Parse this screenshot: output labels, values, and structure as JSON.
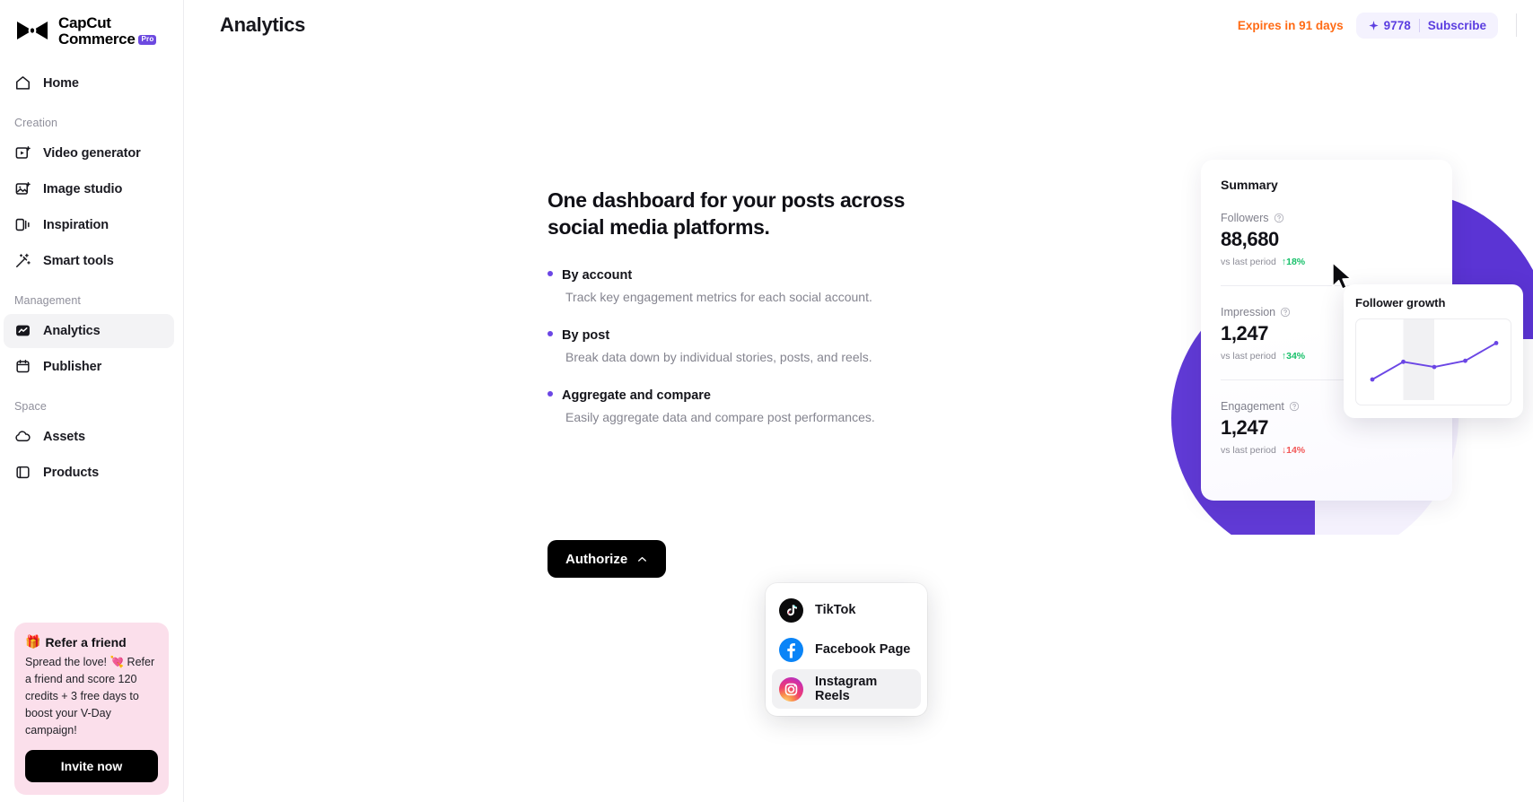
{
  "brand": {
    "line1": "CapCut",
    "line2": "Commerce",
    "badge": "Pro"
  },
  "sidebar": {
    "home": {
      "label": "Home",
      "icon": "home-icon"
    },
    "sections": [
      {
        "label": "Creation",
        "items": [
          {
            "label": "Video generator",
            "icon": "video-generator-icon"
          },
          {
            "label": "Image studio",
            "icon": "image-studio-icon"
          },
          {
            "label": "Inspiration",
            "icon": "inspiration-icon"
          },
          {
            "label": "Smart tools",
            "icon": "smart-tools-icon"
          }
        ]
      },
      {
        "label": "Management",
        "items": [
          {
            "label": "Analytics",
            "icon": "analytics-icon"
          },
          {
            "label": "Publisher",
            "icon": "publisher-icon"
          }
        ]
      },
      {
        "label": "Space",
        "items": [
          {
            "label": "Assets",
            "icon": "assets-icon"
          },
          {
            "label": "Products",
            "icon": "products-icon"
          }
        ]
      }
    ],
    "refer": {
      "emoji": "🎁",
      "title": "Refer a friend",
      "body": "Spread the love! 💘 Refer a friend and score 120 credits + 3 free days to boost your V-Day campaign!",
      "cta": "Invite now"
    }
  },
  "header": {
    "title": "Analytics",
    "expires": "Expires in 91 days",
    "credits": "9778",
    "subscribe": "Subscribe"
  },
  "hero": {
    "heading": "One dashboard for your posts across social media platforms.",
    "features": [
      {
        "title": "By account",
        "desc": "Track key engagement metrics for each social account."
      },
      {
        "title": "By post",
        "desc": "Break data down by individual stories, posts, and reels."
      },
      {
        "title": "Aggregate and compare",
        "desc": "Easily aggregate data and compare post performances."
      }
    ],
    "authorize_label": "Authorize",
    "menu": [
      {
        "label": "TikTok",
        "icon": "tiktok-icon"
      },
      {
        "label": "Facebook Page",
        "icon": "facebook-icon"
      },
      {
        "label": "Instagram Reels",
        "icon": "instagram-icon"
      }
    ]
  },
  "summary": {
    "title": "Summary",
    "metrics": [
      {
        "label": "Followers",
        "value": "88,680",
        "sub": "vs last period",
        "delta": "18%",
        "dir": "up"
      },
      {
        "label": "Impression",
        "value": "1,247",
        "sub": "vs last period",
        "delta": "34%",
        "dir": "up"
      },
      {
        "label": "Engagement",
        "value": "1,247",
        "sub": "vs last period",
        "delta": "14%",
        "dir": "down"
      }
    ]
  },
  "tooltip": {
    "title": "Follower growth"
  },
  "chart_data": {
    "type": "line",
    "title": "Follower growth",
    "x": [
      0,
      1,
      2,
      3,
      4
    ],
    "series": [
      {
        "name": "Followers",
        "values": [
          12,
          46,
          36,
          48,
          82
        ]
      }
    ],
    "xlabel": "",
    "ylabel": "",
    "ylim": [
      0,
      100
    ],
    "grid": false,
    "legend": "none",
    "annotations": [
      "shaded band between x=1 and x=2"
    ]
  },
  "colors": {
    "accent": "#6b46e5",
    "deep_purple": "#5b34d4",
    "orange": "#ff6b15",
    "green": "#17c06a",
    "red": "#f25757",
    "pink_card": "#fbdfeb"
  }
}
